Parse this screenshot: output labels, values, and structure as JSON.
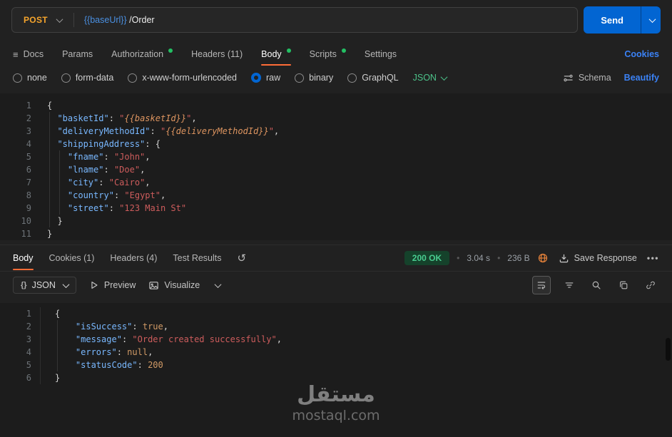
{
  "colors": {
    "method_post": "#f6a52c",
    "send_button": "#0265d2",
    "link_blue": "#3b82f6",
    "url_variable": "#4a90e2",
    "success_green": "#4cc38a",
    "status_dot_green": "#23bf63",
    "active_tab_underline": "#ff6c37",
    "status_badge_bg": "#15422b",
    "key_token": "#79b8ff",
    "string_token": "#cd5c5c",
    "variable_token": "#de9560",
    "keyword_token": "#d19a66"
  },
  "request": {
    "method": "POST",
    "url_variable": "{{baseUrl}}",
    "url_path": "/Order",
    "send": "Send"
  },
  "tabs": {
    "docs": "Docs",
    "params": "Params",
    "authorization": "Authorization",
    "headers": "Headers (11)",
    "body": "Body",
    "scripts": "Scripts",
    "settings": "Settings",
    "cookies": "Cookies"
  },
  "body_options": {
    "none": "none",
    "form_data": "form-data",
    "urlencoded": "x-www-form-urlencoded",
    "raw": "raw",
    "binary": "binary",
    "graphql": "GraphQL",
    "language": "JSON",
    "schema": "Schema",
    "beautify": "Beautify"
  },
  "icons": {
    "docs": "≡",
    "history": "↺",
    "more": "•••",
    "braces": "{}"
  },
  "request_code": [
    [
      [
        "{",
        "pl"
      ]
    ],
    [
      [
        "  ",
        "pl"
      ],
      [
        "\"basketId\"",
        "key"
      ],
      [
        ": ",
        "pl"
      ],
      [
        "\"",
        "str"
      ],
      [
        "{{basketId}}",
        "var"
      ],
      [
        "\"",
        "str"
      ],
      [
        ",",
        "pl"
      ]
    ],
    [
      [
        "  ",
        "pl"
      ],
      [
        "\"deliveryMethodId\"",
        "key"
      ],
      [
        ": ",
        "pl"
      ],
      [
        "\"",
        "str"
      ],
      [
        "{{deliveryMethodId}}",
        "var"
      ],
      [
        "\"",
        "str"
      ],
      [
        ",",
        "pl"
      ]
    ],
    [
      [
        "  ",
        "pl"
      ],
      [
        "\"shippingAddress\"",
        "key"
      ],
      [
        ": {",
        "pl"
      ]
    ],
    [
      [
        "    ",
        "pl"
      ],
      [
        "\"fname\"",
        "key"
      ],
      [
        ": ",
        "pl"
      ],
      [
        "\"John\"",
        "str"
      ],
      [
        ",",
        "pl"
      ]
    ],
    [
      [
        "    ",
        "pl"
      ],
      [
        "\"lname\"",
        "key"
      ],
      [
        ": ",
        "pl"
      ],
      [
        "\"Doe\"",
        "str"
      ],
      [
        ",",
        "pl"
      ]
    ],
    [
      [
        "    ",
        "pl"
      ],
      [
        "\"city\"",
        "key"
      ],
      [
        ": ",
        "pl"
      ],
      [
        "\"Cairo\"",
        "str"
      ],
      [
        ",",
        "pl"
      ]
    ],
    [
      [
        "    ",
        "pl"
      ],
      [
        "\"country\"",
        "key"
      ],
      [
        ": ",
        "pl"
      ],
      [
        "\"Egypt\"",
        "str"
      ],
      [
        ",",
        "pl"
      ]
    ],
    [
      [
        "    ",
        "pl"
      ],
      [
        "\"street\"",
        "key"
      ],
      [
        ": ",
        "pl"
      ],
      [
        "\"123 Main St\"",
        "str"
      ]
    ],
    [
      [
        "  }",
        "pl"
      ]
    ],
    [
      [
        "}",
        "pl"
      ]
    ]
  ],
  "response": {
    "tab_body": "Body",
    "tab_cookies": "Cookies (1)",
    "tab_headers": "Headers (4)",
    "tab_tests": "Test Results",
    "status": "200 OK",
    "time": "3.04 s",
    "size": "236 B",
    "save": "Save Response",
    "format": "JSON",
    "preview": "Preview",
    "visualize": "Visualize"
  },
  "response_code": [
    [
      [
        "{",
        "pl"
      ]
    ],
    [
      [
        "    ",
        "pl"
      ],
      [
        "\"isSuccess\"",
        "key"
      ],
      [
        ": ",
        "pl"
      ],
      [
        "true",
        "kw"
      ],
      [
        ",",
        "pl"
      ]
    ],
    [
      [
        "    ",
        "pl"
      ],
      [
        "\"message\"",
        "key"
      ],
      [
        ": ",
        "pl"
      ],
      [
        "\"Order created successfully\"",
        "str"
      ],
      [
        ",",
        "pl"
      ]
    ],
    [
      [
        "    ",
        "pl"
      ],
      [
        "\"errors\"",
        "key"
      ],
      [
        ": ",
        "pl"
      ],
      [
        "null",
        "kw"
      ],
      [
        ",",
        "pl"
      ]
    ],
    [
      [
        "    ",
        "pl"
      ],
      [
        "\"statusCode\"",
        "key"
      ],
      [
        ": ",
        "pl"
      ],
      [
        "200",
        "num"
      ]
    ],
    [
      [
        "}",
        "pl"
      ]
    ]
  ],
  "watermark": {
    "title": "مستقل",
    "domain": "mostaql.com"
  }
}
